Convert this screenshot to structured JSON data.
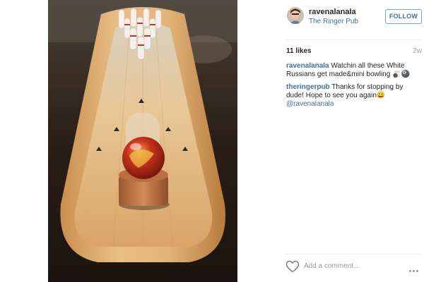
{
  "post": {
    "username": "ravenalanala",
    "location": "The Ringer Pub",
    "follow_label": "FOLLOW",
    "likes": "11 likes",
    "time_ago": "2w"
  },
  "comments": [
    {
      "user": "ravenalanala",
      "text": "Watchin all these White Russians get made&mini bowling 🎳🎱",
      "mention": ""
    },
    {
      "user": "theringerpub",
      "text": "Thanks for stopping by dude! Hope to see you again😀 ",
      "mention": "@ravenalanala"
    }
  ],
  "comment_box": {
    "placeholder": "Add a comment..."
  },
  "icons": {
    "like": "heart-icon",
    "more": "more-options-icon"
  },
  "colors": {
    "link": "#3f729b",
    "follow_border": "#70a2c9",
    "muted": "#a5a7aa"
  }
}
